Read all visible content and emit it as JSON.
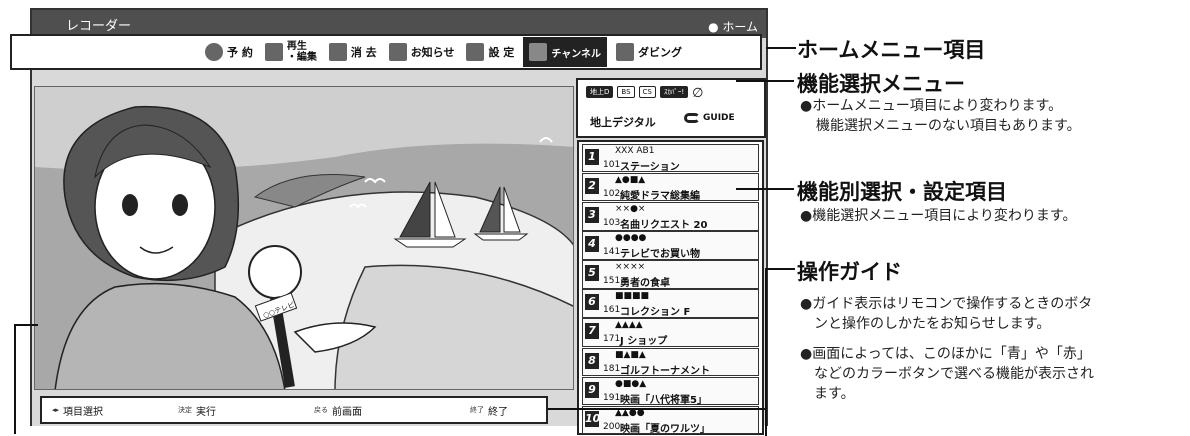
{
  "screen": {
    "app_title": "レコーダー",
    "home_label": "ホーム"
  },
  "menu": {
    "items": [
      {
        "label": "予 約",
        "icon": "clock-icon"
      },
      {
        "label": "再生\n・編集",
        "icon": "book-icon"
      },
      {
        "label": "消 去",
        "icon": "trash-icon"
      },
      {
        "label": "お知らせ",
        "icon": "envelope-icon"
      },
      {
        "label": "設 定",
        "icon": "settings-icon"
      },
      {
        "label": "チャンネル",
        "icon": "channel-icon"
      },
      {
        "label": "ダビング",
        "icon": "dubbing-icon"
      }
    ],
    "active_index": 5
  },
  "funcmenu": {
    "buttons": [
      "地上D",
      "BS",
      "CS",
      "ｽｶﾊﾟｰ!",
      "∅"
    ],
    "dtv_label": "地上デジタル",
    "guide_label": "GUIDE"
  },
  "channels": [
    {
      "num": "1",
      "title": "XXX AB1",
      "ch": "101",
      "name": "ステーション"
    },
    {
      "num": "2",
      "title": "▲●■▲",
      "ch": "102",
      "name": "純愛ドラマ総集編"
    },
    {
      "num": "3",
      "title": "××●×",
      "ch": "103",
      "name": "名曲リクエスト 20"
    },
    {
      "num": "4",
      "title": "●●●●",
      "ch": "141",
      "name": "テレビでお買い物"
    },
    {
      "num": "5",
      "title": "××××",
      "ch": "151",
      "name": "勇者の食卓"
    },
    {
      "num": "6",
      "title": "■■■■",
      "ch": "161",
      "name": "コレクション F"
    },
    {
      "num": "7",
      "title": "▲▲▲▲",
      "ch": "171",
      "name": "J ショップ"
    },
    {
      "num": "8",
      "title": "■▲■▲",
      "ch": "181",
      "name": "ゴルフトーナメント"
    },
    {
      "num": "9",
      "title": "●■●▲",
      "ch": "191",
      "name": "映画「八代将軍5」"
    },
    {
      "num": "10",
      "title": "▲▲●●",
      "ch": "200",
      "name": "映画「夏のワルツ」"
    }
  ],
  "guide": {
    "select_key": "◂▸",
    "select_label": "項目選択",
    "ok_key": "決定",
    "ok_label": "実行",
    "back_key": "戻る",
    "back_label": "前画面",
    "end_key": "終了",
    "end_label": "終了"
  },
  "mic_label": "○○テレビ",
  "annotations": {
    "home_menu": "ホームメニュー項目",
    "func_menu": "機能選択メニュー",
    "func_desc1": "●ホームメニュー項目により変わります。",
    "func_desc2": "機能選択メニューのない項目もあります。",
    "func_items": "機能別選択・設定項目",
    "func_items_desc": "●機能選択メニュー項目により変わります。",
    "op_guide": "操作ガイド",
    "op_desc1a": "●ガイド表示はリモコンで操作するときのボタ",
    "op_desc1b": "ンと操作のしかたをお知らせします。",
    "op_desc2a": "●画面によっては、このほかに「青」や「赤」",
    "op_desc2b": "などのカラーボタンで選べる機能が表示され",
    "op_desc2c": "ます。"
  }
}
